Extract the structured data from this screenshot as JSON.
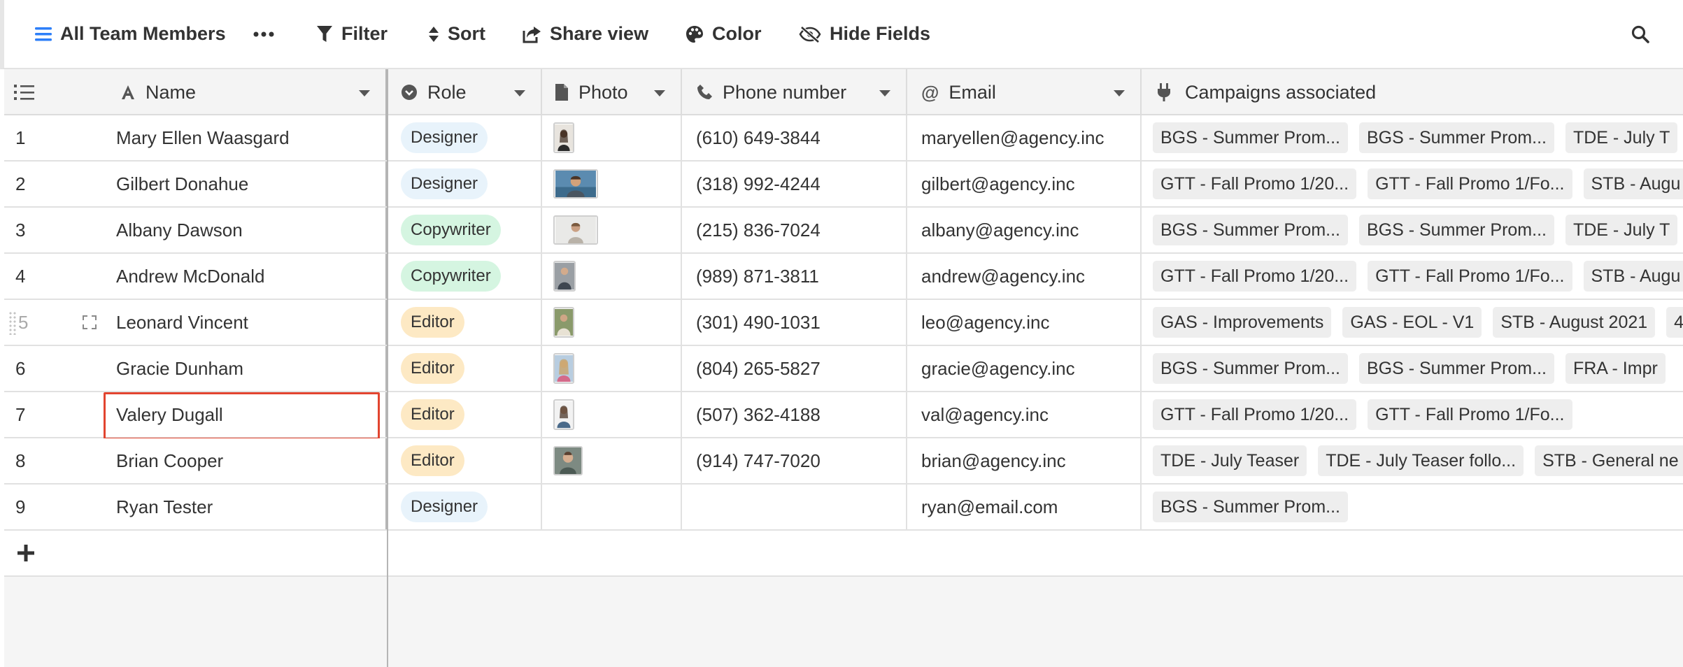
{
  "toolbar": {
    "view_label": "All Team Members",
    "filter_label": "Filter",
    "sort_label": "Sort",
    "share_label": "Share view",
    "color_label": "Color",
    "hide_label": "Hide Fields",
    "icons": [
      "menu-icon",
      "more-icon",
      "filter-icon",
      "sort-icon",
      "share-icon",
      "palette-icon",
      "eye-slash-icon",
      "search-icon"
    ]
  },
  "columns": {
    "name": "Name",
    "role": "Role",
    "photo": "Photo",
    "phone": "Phone number",
    "email": "Email",
    "campaigns": "Campaigns associated"
  },
  "colors": {
    "designer": "#e8f3fb",
    "copywriter": "#d5f5e1",
    "editor": "#fde9c4",
    "selection": "#e2442f"
  },
  "rows": [
    {
      "num": "1",
      "name": "Mary Ellen Waasgard",
      "role": "Designer",
      "phone": "(610) 649-3844",
      "email": "maryellen@agency.inc",
      "campaigns": [
        "BGS - Summer Prom...",
        "BGS - Summer Prom...",
        "TDE - July T"
      ]
    },
    {
      "num": "2",
      "name": "Gilbert Donahue",
      "role": "Designer",
      "phone": "(318) 992-4244",
      "email": "gilbert@agency.inc",
      "campaigns": [
        "GTT - Fall Promo 1/20...",
        "GTT - Fall Promo 1/Fo...",
        "STB - Augu"
      ]
    },
    {
      "num": "3",
      "name": "Albany Dawson",
      "role": "Copywriter",
      "phone": "(215) 836-7024",
      "email": "albany@agency.inc",
      "campaigns": [
        "BGS - Summer Prom...",
        "BGS - Summer Prom...",
        "TDE - July T"
      ]
    },
    {
      "num": "4",
      "name": "Andrew McDonald",
      "role": "Copywriter",
      "phone": "(989) 871-3811",
      "email": "andrew@agency.inc",
      "campaigns": [
        "GTT - Fall Promo 1/20...",
        "GTT - Fall Promo 1/Fo...",
        "STB - Augu"
      ]
    },
    {
      "num": "5",
      "name": "Leonard Vincent",
      "role": "Editor",
      "phone": "(301) 490-1031",
      "email": "leo@agency.inc",
      "campaigns": [
        "GAS - Improvements",
        "GAS - EOL - V1",
        "STB - August 2021",
        "4"
      ]
    },
    {
      "num": "6",
      "name": "Gracie Dunham",
      "role": "Editor",
      "phone": "(804) 265-5827",
      "email": "gracie@agency.inc",
      "campaigns": [
        "BGS - Summer Prom...",
        "BGS - Summer Prom...",
        "FRA - Impr"
      ]
    },
    {
      "num": "7",
      "name": "Valery Dugall",
      "role": "Editor",
      "phone": "(507) 362-4188",
      "email": "val@agency.inc",
      "campaigns": [
        "GTT - Fall Promo 1/20...",
        "GTT - Fall Promo 1/Fo..."
      ]
    },
    {
      "num": "8",
      "name": "Brian Cooper",
      "role": "Editor",
      "phone": "(914) 747-7020",
      "email": "brian@agency.inc",
      "campaigns": [
        "TDE - July Teaser",
        "TDE - July Teaser follo...",
        "STB - General ne"
      ]
    },
    {
      "num": "9",
      "name": "Ryan Tester",
      "role": "Designer",
      "phone": "",
      "email": "ryan@email.com",
      "campaigns": [
        "BGS - Summer Prom..."
      ]
    }
  ]
}
